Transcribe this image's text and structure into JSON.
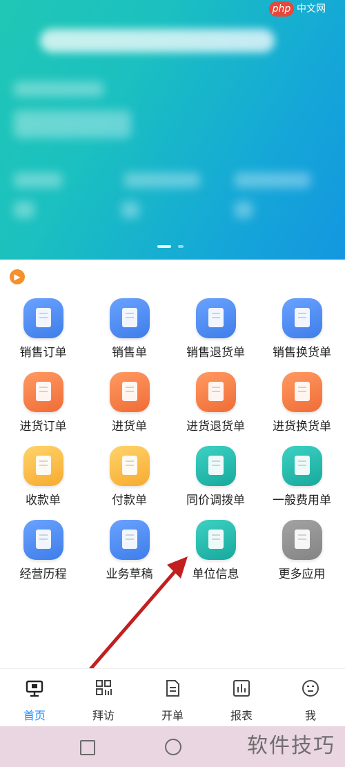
{
  "watermark_top": {
    "badge": "php",
    "site": "中文网"
  },
  "quick_actions": [
    {
      "label": "销售订单",
      "icon": "sales-order-icon",
      "color": "blue"
    },
    {
      "label": "销售单",
      "icon": "sales-receipt-icon",
      "color": "blue"
    },
    {
      "label": "销售退货单",
      "icon": "sales-return-icon",
      "color": "blue"
    },
    {
      "label": "销售换货单",
      "icon": "sales-exchange-icon",
      "color": "blue"
    },
    {
      "label": "进货订单",
      "icon": "purchase-order-icon",
      "color": "orange"
    },
    {
      "label": "进货单",
      "icon": "purchase-receipt-icon",
      "color": "orange"
    },
    {
      "label": "进货退货单",
      "icon": "purchase-return-icon",
      "color": "orange"
    },
    {
      "label": "进货换货单",
      "icon": "purchase-exchange-icon",
      "color": "orange"
    },
    {
      "label": "收款单",
      "icon": "collection-icon",
      "color": "yellow"
    },
    {
      "label": "付款单",
      "icon": "payment-icon",
      "color": "yellow"
    },
    {
      "label": "同价调拨单",
      "icon": "transfer-icon",
      "color": "teal"
    },
    {
      "label": "一般费用单",
      "icon": "expense-icon",
      "color": "teal"
    },
    {
      "label": "经营历程",
      "icon": "business-history-icon",
      "color": "blue"
    },
    {
      "label": "业务草稿",
      "icon": "draft-icon",
      "color": "blue"
    },
    {
      "label": "单位信息",
      "icon": "unit-info-icon",
      "color": "teal"
    },
    {
      "label": "更多应用",
      "icon": "more-apps-icon",
      "color": "gray"
    }
  ],
  "tabs": [
    {
      "label": "首页",
      "icon": "home-icon",
      "active": true
    },
    {
      "label": "拜访",
      "icon": "visit-icon",
      "active": false
    },
    {
      "label": "开单",
      "icon": "order-icon",
      "active": false
    },
    {
      "label": "报表",
      "icon": "report-icon",
      "active": false
    },
    {
      "label": "我",
      "icon": "profile-icon",
      "active": false
    }
  ],
  "watermark_bottom": "软件技巧",
  "colors": {
    "active_tab": "#1a8cff",
    "arrow": "#c21f1f"
  }
}
